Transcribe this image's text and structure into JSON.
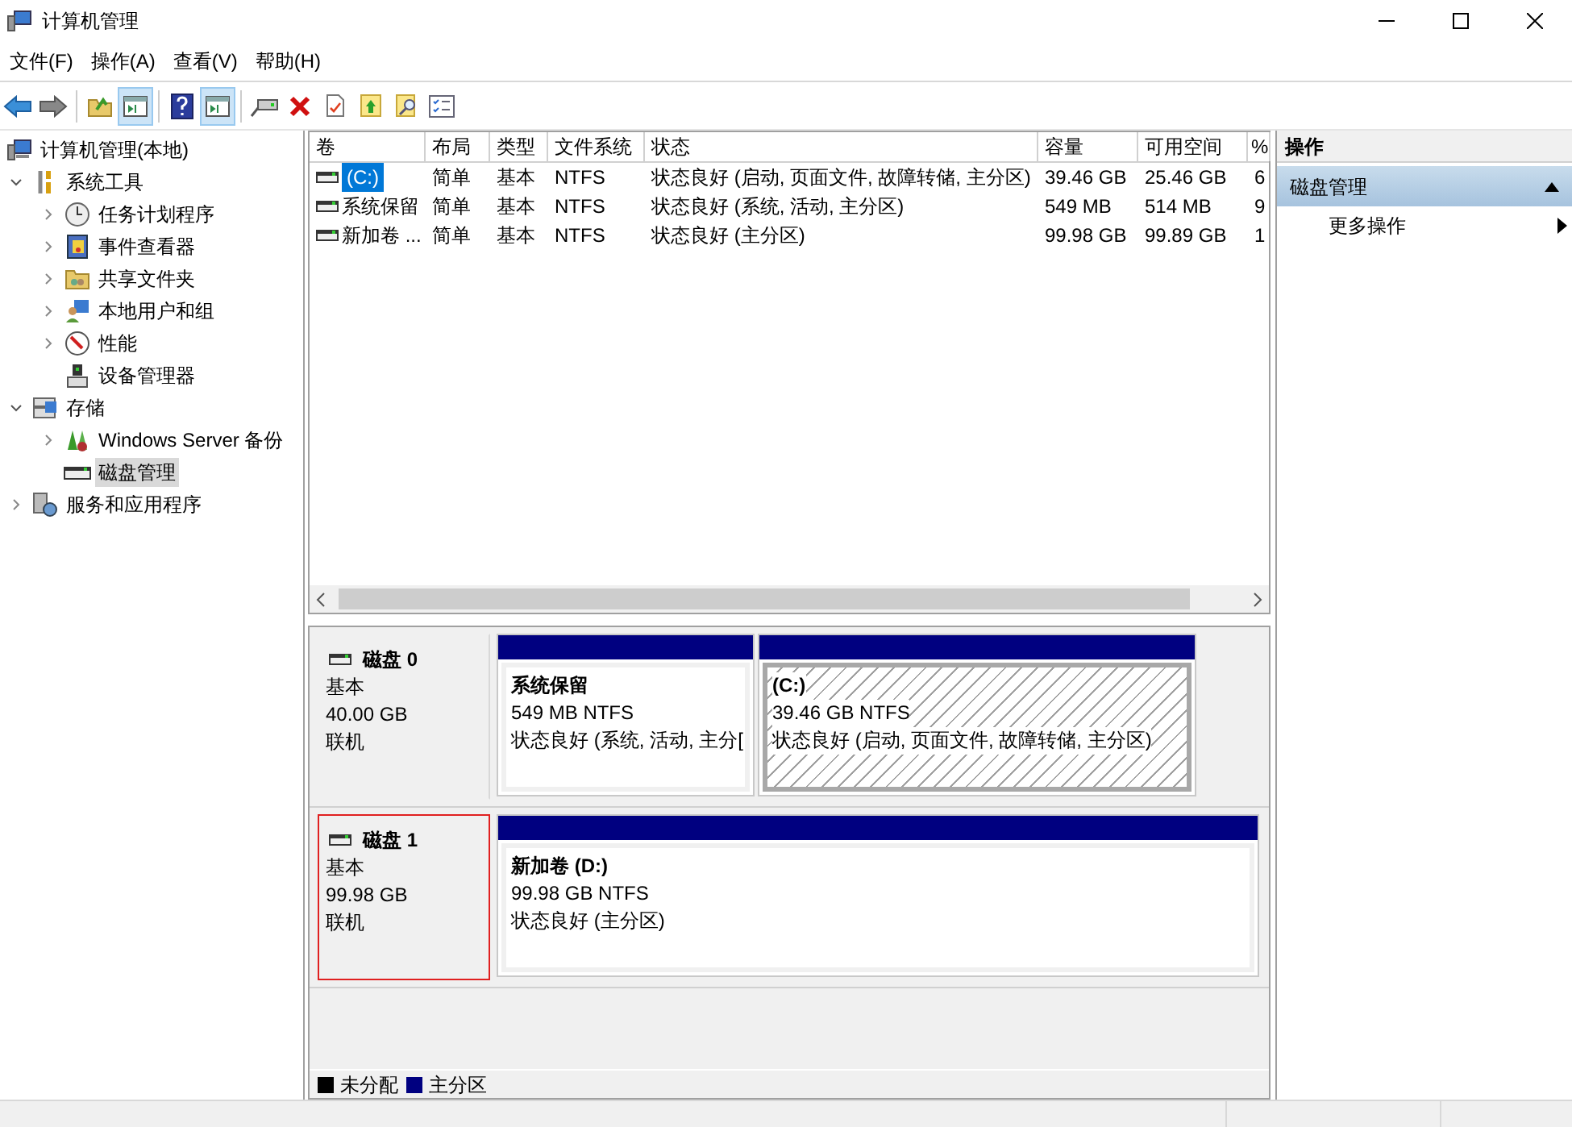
{
  "window": {
    "title": "计算机管理"
  },
  "menu": [
    "文件(F)",
    "操作(A)",
    "查看(V)",
    "帮助(H)"
  ],
  "toolbar": [
    {
      "kind": "back",
      "pressed": false
    },
    {
      "kind": "forward",
      "pressed": false
    },
    {
      "kind": "sep"
    },
    {
      "kind": "up",
      "pressed": false
    },
    {
      "kind": "panel",
      "pressed": true
    },
    {
      "kind": "sep"
    },
    {
      "kind": "help",
      "pressed": false
    },
    {
      "kind": "panel",
      "pressed": true
    },
    {
      "kind": "sep"
    },
    {
      "kind": "drive",
      "pressed": false
    },
    {
      "kind": "delete",
      "pressed": false
    },
    {
      "kind": "doc",
      "pressed": false
    },
    {
      "kind": "folderup",
      "pressed": false
    },
    {
      "kind": "search",
      "pressed": false
    },
    {
      "kind": "list",
      "pressed": false
    }
  ],
  "tree": [
    {
      "label": "计算机管理(本地)",
      "selected": false,
      "children": [
        {
          "label": "系统工具",
          "selected": false,
          "expanded": true,
          "children": [
            {
              "label": "任务计划程序",
              "selected": false,
              "expanded": false
            },
            {
              "label": "事件查看器",
              "selected": false,
              "expanded": false
            },
            {
              "label": "共享文件夹",
              "selected": false,
              "expanded": false
            },
            {
              "label": "本地用户和组",
              "selected": false,
              "expanded": false
            },
            {
              "label": "性能",
              "selected": false,
              "expanded": false
            },
            {
              "label": "设备管理器",
              "selected": false
            }
          ]
        },
        {
          "label": "存储",
          "selected": false,
          "expanded": true,
          "children": [
            {
              "label": "Windows Server 备份",
              "selected": false,
              "expanded": false
            },
            {
              "label": "磁盘管理",
              "selected": true
            }
          ]
        },
        {
          "label": "服务和应用程序",
          "selected": false,
          "expanded": false
        }
      ]
    }
  ],
  "table": {
    "columns": [
      "卷",
      "布局",
      "类型",
      "文件系统",
      "状态",
      "容量",
      "可用空间",
      "%"
    ],
    "rows": [
      {
        "selected": true,
        "cells": [
          "(C:)",
          "简单",
          "基本",
          "NTFS",
          "状态良好 (启动, 页面文件, 故障转储, 主分区)",
          "39.46 GB",
          "25.46 GB",
          "6"
        ]
      },
      {
        "selected": false,
        "cells": [
          "系统保留",
          "简单",
          "基本",
          "NTFS",
          "状态良好 (系统, 活动, 主分区)",
          "549 MB",
          "514 MB",
          "9"
        ]
      },
      {
        "selected": false,
        "cells": [
          "新加卷 ...",
          "简单",
          "基本",
          "NTFS",
          "状态良好 (主分区)",
          "99.98 GB",
          "99.89 GB",
          "1"
        ]
      }
    ]
  },
  "disks": [
    {
      "name": "磁盘 0",
      "type": "基本",
      "size": "40.00 GB",
      "status": "联机",
      "selected": false,
      "partitions": [
        {
          "name": "系统保留",
          "size": "549 MB NTFS",
          "status": "状态良好 (系统, 活动, 主分[",
          "selected": false
        },
        {
          "name": "(C:)",
          "size": "39.46 GB NTFS",
          "status": "状态良好 (启动, 页面文件, 故障转储, 主分区)",
          "selected": true
        }
      ]
    },
    {
      "name": "磁盘 1",
      "type": "基本",
      "size": "99.98 GB",
      "status": "联机",
      "selected": true,
      "partitions": [
        {
          "name": "新加卷  (D:)",
          "size": "99.98 GB NTFS",
          "status": "状态良好 (主分区)",
          "selected": false
        }
      ]
    }
  ],
  "legend": [
    {
      "label": "未分配",
      "color": "#000000"
    },
    {
      "label": "主分区",
      "color": "#000080"
    }
  ],
  "actions": {
    "title": "操作",
    "section": {
      "label": "磁盘管理",
      "expanded": true
    },
    "items": [
      "更多操作"
    ]
  }
}
